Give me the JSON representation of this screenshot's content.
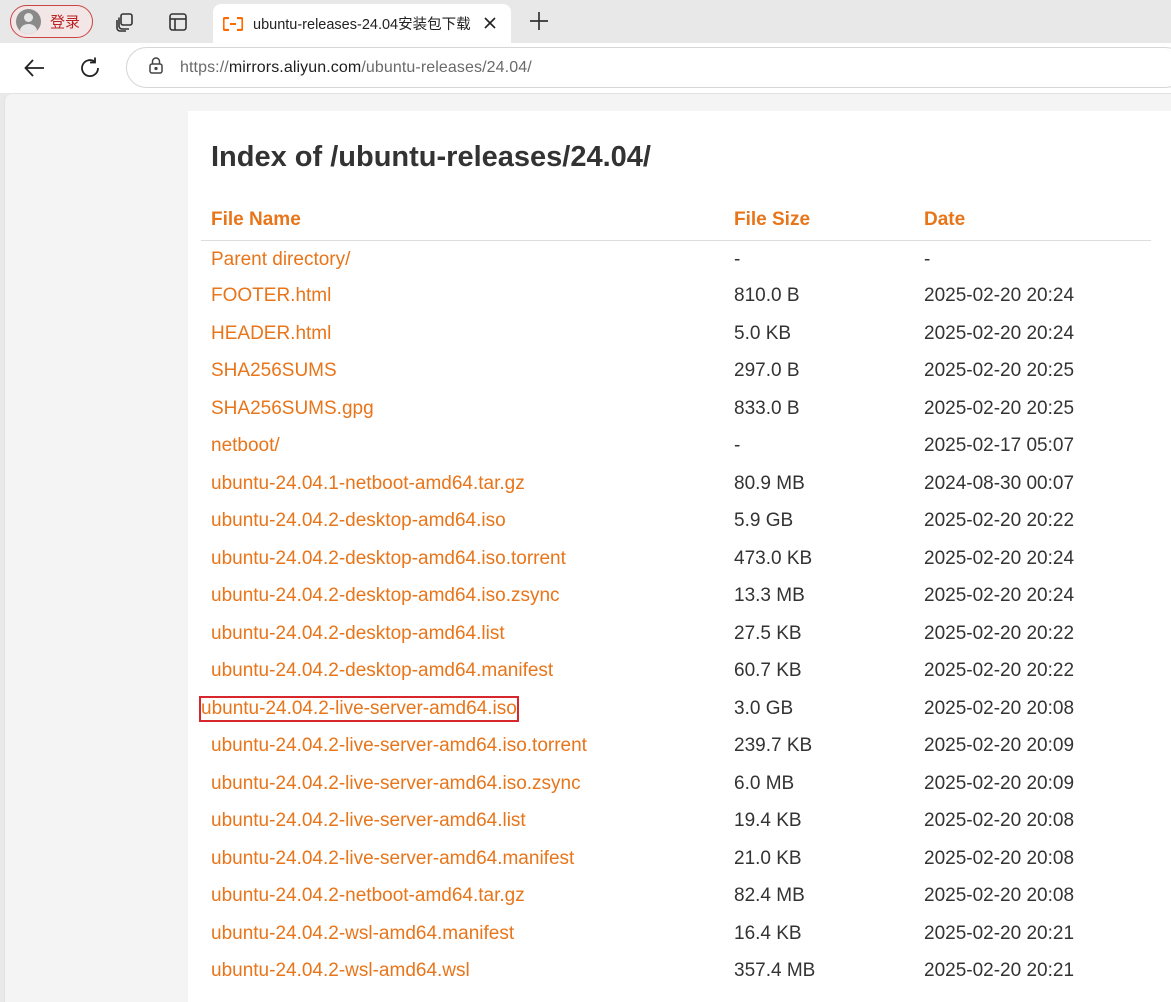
{
  "browser": {
    "profile_label": "登录",
    "tab_title": "ubuntu-releases-24.04安装包下载",
    "url_scheme": "https://",
    "url_host": "mirrors.aliyun.com",
    "url_path": "/ubuntu-releases/24.04/"
  },
  "page": {
    "heading": "Index of /ubuntu-releases/24.04/",
    "columns": {
      "name": "File Name",
      "size": "File Size",
      "date": "Date"
    },
    "highlighted_file": "ubuntu-24.04.2-live-server-amd64.iso",
    "accent_color": "#e8751a",
    "highlight_color": "#d7262c",
    "rows": [
      {
        "name": "Parent directory/",
        "size": "-",
        "date": "-"
      },
      {
        "name": "FOOTER.html",
        "size": "810.0 B",
        "date": "2025-02-20 20:24"
      },
      {
        "name": "HEADER.html",
        "size": "5.0 KB",
        "date": "2025-02-20 20:24"
      },
      {
        "name": "SHA256SUMS",
        "size": "297.0 B",
        "date": "2025-02-20 20:25"
      },
      {
        "name": "SHA256SUMS.gpg",
        "size": "833.0 B",
        "date": "2025-02-20 20:25"
      },
      {
        "name": "netboot/",
        "size": "-",
        "date": "2025-02-17 05:07"
      },
      {
        "name": "ubuntu-24.04.1-netboot-amd64.tar.gz",
        "size": "80.9 MB",
        "date": "2024-08-30 00:07"
      },
      {
        "name": "ubuntu-24.04.2-desktop-amd64.iso",
        "size": "5.9 GB",
        "date": "2025-02-20 20:22"
      },
      {
        "name": "ubuntu-24.04.2-desktop-amd64.iso.torrent",
        "size": "473.0 KB",
        "date": "2025-02-20 20:24"
      },
      {
        "name": "ubuntu-24.04.2-desktop-amd64.iso.zsync",
        "size": "13.3 MB",
        "date": "2025-02-20 20:24"
      },
      {
        "name": "ubuntu-24.04.2-desktop-amd64.list",
        "size": "27.5 KB",
        "date": "2025-02-20 20:22"
      },
      {
        "name": "ubuntu-24.04.2-desktop-amd64.manifest",
        "size": "60.7 KB",
        "date": "2025-02-20 20:22"
      },
      {
        "name": "ubuntu-24.04.2-live-server-amd64.iso",
        "size": "3.0 GB",
        "date": "2025-02-20 20:08"
      },
      {
        "name": "ubuntu-24.04.2-live-server-amd64.iso.torrent",
        "size": "239.7 KB",
        "date": "2025-02-20 20:09"
      },
      {
        "name": "ubuntu-24.04.2-live-server-amd64.iso.zsync",
        "size": "6.0 MB",
        "date": "2025-02-20 20:09"
      },
      {
        "name": "ubuntu-24.04.2-live-server-amd64.list",
        "size": "19.4 KB",
        "date": "2025-02-20 20:08"
      },
      {
        "name": "ubuntu-24.04.2-live-server-amd64.manifest",
        "size": "21.0 KB",
        "date": "2025-02-20 20:08"
      },
      {
        "name": "ubuntu-24.04.2-netboot-amd64.tar.gz",
        "size": "82.4 MB",
        "date": "2025-02-20 20:08"
      },
      {
        "name": "ubuntu-24.04.2-wsl-amd64.manifest",
        "size": "16.4 KB",
        "date": "2025-02-20 20:21"
      },
      {
        "name": "ubuntu-24.04.2-wsl-amd64.wsl",
        "size": "357.4 MB",
        "date": "2025-02-20 20:21"
      }
    ]
  }
}
